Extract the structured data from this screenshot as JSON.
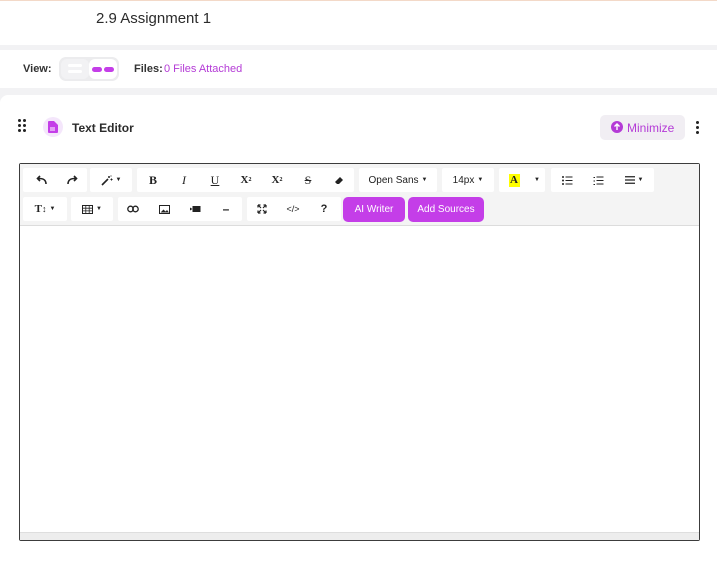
{
  "assignment": {
    "title": "2.9 Assignment 1"
  },
  "view": {
    "label": "View:",
    "list_icon": "list-view-icon",
    "grid_icon": "grid-view-icon"
  },
  "files": {
    "label": "Files:",
    "link_text": "0 Files Attached"
  },
  "editor": {
    "title": "Text Editor",
    "icon": "document-icon",
    "minimize_label": "Minimize",
    "toolbar": {
      "undo": "undo-icon",
      "redo": "redo-icon",
      "magic": "magic-wand-icon",
      "bold": "B",
      "italic": "I",
      "underline": "U",
      "superscript": "X",
      "subscript": "X",
      "strikethrough": "S",
      "eraser": "eraser-icon",
      "font_family": "Open Sans",
      "font_size": "14px",
      "text_color": "A",
      "bullet_list": "unordered-list-icon",
      "numbered_list": "ordered-list-icon",
      "align": "align-icon",
      "text_style": "T",
      "table": "table-icon",
      "link": "link-icon",
      "image": "image-icon",
      "video": "video-icon",
      "hr": "–",
      "fullscreen": "fullscreen-icon",
      "code": "</>",
      "help": "?",
      "ai_writer": "AI Writer",
      "add_sources": "Add Sources"
    },
    "content": ""
  },
  "colors": {
    "accent": "#c43ee8",
    "link": "#b43bd6",
    "highlight": "#ffff00"
  }
}
